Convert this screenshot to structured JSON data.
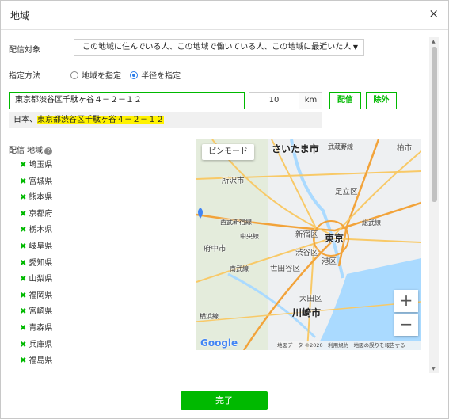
{
  "dialog": {
    "title": "地域",
    "close_icon": "×"
  },
  "delivery_target": {
    "label": "配信対象",
    "value": "この地域に住んでいる人、この地域で働いている人、この地域に最近いた人",
    "caret": "▼"
  },
  "method": {
    "label": "指定方法",
    "options": [
      {
        "label": "地域を指定",
        "selected": false
      },
      {
        "label": "半径を指定",
        "selected": true
      }
    ]
  },
  "radius": {
    "address": "東京都渋谷区千駄ヶ谷４－２－１２",
    "distance": "10",
    "unit": "km",
    "deliver_button": "配信",
    "exclude_button": "除外"
  },
  "suggestion": {
    "prefix": "日本、",
    "highlight": "東京都渋谷区千駄ヶ谷４－２－１２"
  },
  "regions": {
    "title": "配信 地域",
    "help_icon": "?",
    "remove_icon": "✖",
    "items": [
      "埼玉県",
      "宮城県",
      "熊本県",
      "京都府",
      "栃木県",
      "岐阜県",
      "愛知県",
      "山梨県",
      "福岡県",
      "宮崎県",
      "青森県",
      "兵庫県",
      "福島県"
    ]
  },
  "map": {
    "pin_mode_button": "ピンモード",
    "zoom_in": "+",
    "zoom_out": "−",
    "footer": "地図データ ©2020　利用規約　地図の誤りを報告する",
    "logo": "Google",
    "labels": {
      "saitama": "さいたま市",
      "musashino": "武蔵野線",
      "kashiwa": "柏市",
      "tokorozawa": "所沢市",
      "adachi": "足立区",
      "nishikokubunji": "西武新宿線",
      "chuo": "中央線",
      "fuchu": "府中市",
      "shinjuku": "新宿区",
      "tokyo": "東京",
      "shibuya": "渋谷区",
      "minato": "港区",
      "keiyo": "総武線",
      "nambu": "南武線",
      "setagaya": "世田谷区",
      "ota": "大田区",
      "kawasaki": "川崎市",
      "yokohama": "横浜線"
    },
    "colors": {
      "water": "#aadaff",
      "road": "#f8c967",
      "highway": "#f2a33a",
      "land": "#eef0f2"
    }
  },
  "footer": {
    "done_button": "完了"
  },
  "colors": {
    "accent": "#00b900",
    "highlight": "#fff200",
    "radio": "#2b7de9"
  }
}
